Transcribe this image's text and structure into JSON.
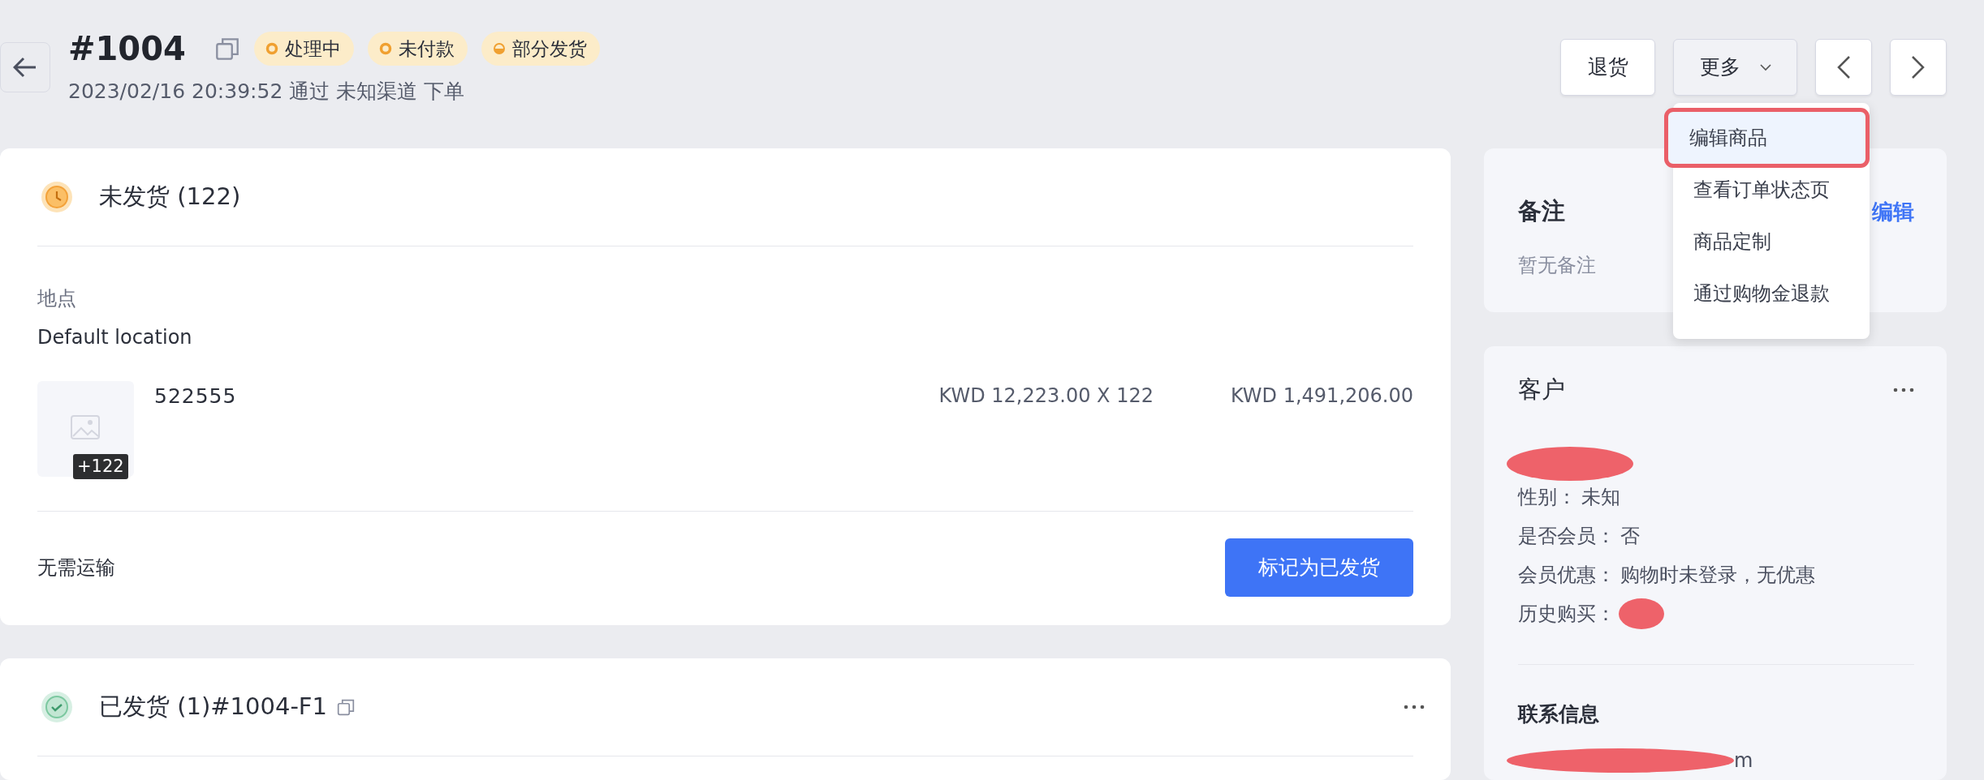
{
  "header": {
    "order_number": "#1004",
    "subtitle": "2023/02/16 20:39:52 通过 未知渠道 下单",
    "badges": [
      {
        "label": "处理中",
        "kind": "ring"
      },
      {
        "label": "未付款",
        "kind": "ring"
      },
      {
        "label": "部分发货",
        "kind": "half"
      }
    ]
  },
  "actions": [
    {
      "kind": "button",
      "label": "退货"
    },
    {
      "kind": "dropdown",
      "label": "更多",
      "expanded": true
    },
    {
      "kind": "prev"
    },
    {
      "kind": "next"
    }
  ],
  "dropdown_menu": [
    {
      "label": "编辑商品",
      "selected": true
    },
    {
      "label": "查看订单状态页",
      "selected": false
    },
    {
      "label": "商品定制",
      "selected": false
    },
    {
      "label": "通过购物金退款",
      "selected": false
    }
  ],
  "unfulfilled": {
    "title": "未发货 (122)",
    "location_label": "地点",
    "location": "Default location",
    "items": [
      {
        "name": "522555",
        "quantity_badge": "+122",
        "unit_price": "KWD 12,223.00 X 122",
        "total": "KWD 1,491,206.00"
      }
    ],
    "shipping_note": "无需运输",
    "button": "标记为已发货"
  },
  "fulfilled": {
    "title": "已发货 (1)#1004-F1"
  },
  "notes": {
    "title": "备注",
    "edit_link": "编辑",
    "empty_text": "暂无备注"
  },
  "customer": {
    "title": "客户",
    "name_redacted": true,
    "fields": [
      {
        "label": "性别：",
        "value": "未知",
        "redacted": false
      },
      {
        "label": "是否会员：",
        "value": "否",
        "redacted": false
      },
      {
        "label": "会员优惠：",
        "value": "购物时未登录，无优惠",
        "redacted": false
      },
      {
        "label": "历史购买：",
        "redacted": true
      }
    ],
    "contact_title": "联系信息",
    "contact_email": {
      "value": "m",
      "redacted": true
    }
  }
}
